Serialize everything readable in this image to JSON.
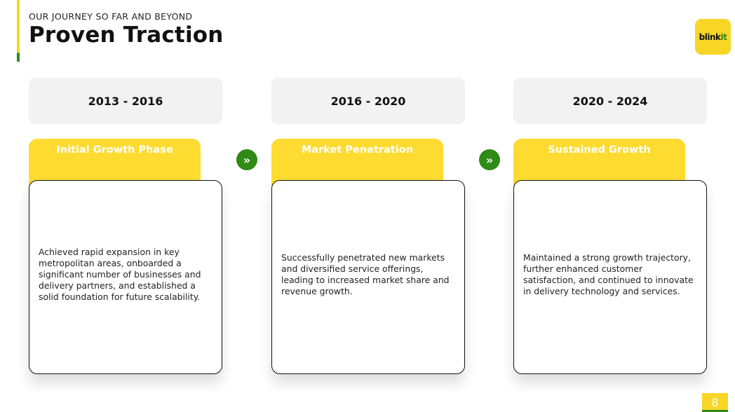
{
  "header": {
    "eyebrow": "OUR JOURNEY SO FAR AND BEYOND",
    "title": "Proven Traction"
  },
  "logo": {
    "text_main": "blink",
    "text_accent": "it"
  },
  "phases": [
    {
      "years": "2013 - 2016",
      "name": "Initial Growth Phase",
      "description": "Achieved rapid expansion in key metropolitan areas, onboarded a significant number of businesses and delivery partners, and established a solid foundation for future scalability."
    },
    {
      "years": "2016 - 2020",
      "name": "Market Penetration",
      "description": "Successfully penetrated new markets and diversified service offerings, leading to increased market share and revenue growth."
    },
    {
      "years": "2020 - 2024",
      "name": "Sustained Growth",
      "description": "Maintained a strong growth trajectory, further enhanced customer satisfaction, and continued to innovate in delivery technology and services."
    }
  ],
  "arrow_glyph": "»",
  "page_number": "8",
  "colors": {
    "accent_yellow": "#fedb30",
    "accent_green": "#2f8a16",
    "year_box_bg": "#f2f2f2"
  },
  "icons": {
    "arrow": "double-chevron-right-icon"
  }
}
